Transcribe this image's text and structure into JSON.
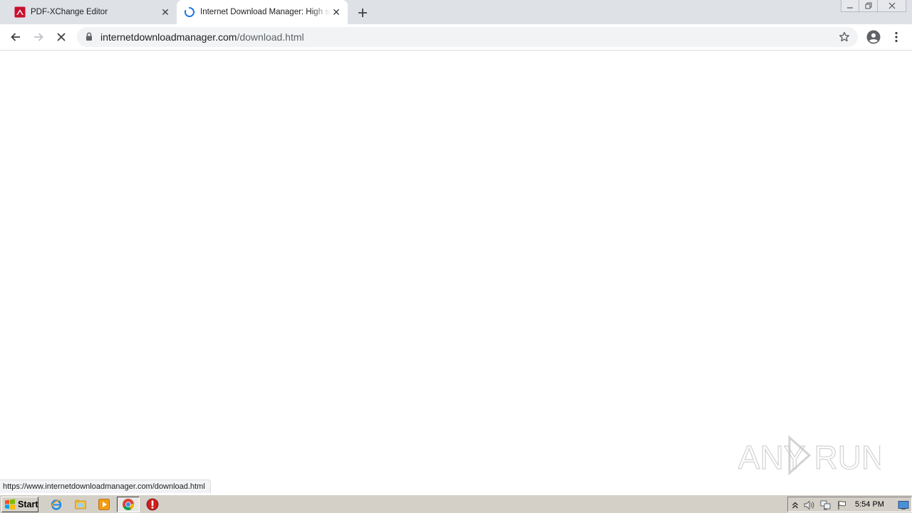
{
  "browser": {
    "tabs": [
      {
        "title": "PDF-XChange Editor",
        "state": "inactive",
        "icon": "pdf-xchange-icon"
      },
      {
        "title": "Internet Download Manager: High sp",
        "state": "active-loading",
        "icon": "loading-spinner-icon"
      }
    ],
    "address_bar": {
      "url_host": "internetdownloadmanager.com",
      "url_path": "/download.html"
    },
    "status_bubble": "https://www.internetdownloadmanager.com/download.html"
  },
  "watermark": {
    "text": "ANY RUN"
  },
  "taskbar": {
    "start_label": "Start",
    "clock": "5:54 PM"
  },
  "colors": {
    "tabstrip_bg": "#dee1e6",
    "omnibox_bg": "#f1f3f4",
    "taskbar_bg": "#d4d0c8",
    "spinner": "#1a73e8"
  }
}
